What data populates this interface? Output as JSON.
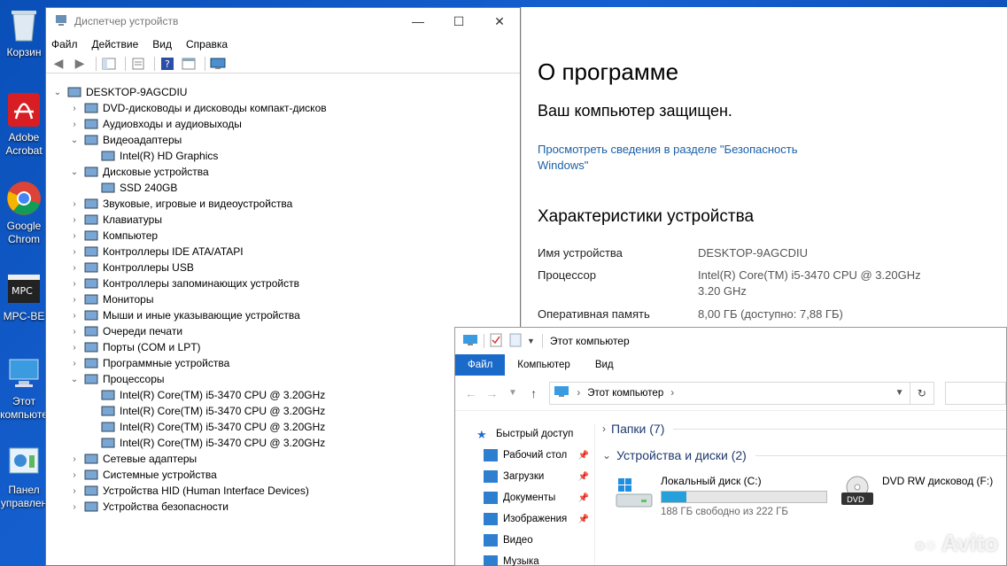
{
  "desktop": {
    "icons": [
      {
        "label": "Корзин",
        "icon": "recycle-bin-icon"
      },
      {
        "label": "Adobe Acrobat",
        "line1": "Adobe",
        "line2": "Acrobat",
        "icon": "acrobat-icon"
      },
      {
        "label": "Google Chrome",
        "line1": "Google",
        "line2": "Chrom",
        "icon": "chrome-icon"
      },
      {
        "label": "MPC-BE",
        "line1": "MPC-BE",
        "icon": "mpc-be-icon"
      },
      {
        "label": "Этот компьютер",
        "line1": "Этот",
        "line2": "компьюте",
        "icon": "this-pc-icon"
      },
      {
        "label": "Панель управления",
        "line1": "Панел",
        "line2": "управлен",
        "icon": "control-panel-icon"
      }
    ]
  },
  "device_manager": {
    "title": "Диспетчер устройств",
    "menu": [
      "Файл",
      "Действие",
      "Вид",
      "Справка"
    ],
    "root": "DESKTOP-9AGCDIU",
    "tree": [
      {
        "label": "DVD-дисководы и дисководы компакт-дисков",
        "expanded": false
      },
      {
        "label": "Аудиовходы и аудиовыходы",
        "expanded": false
      },
      {
        "label": "Видеоадаптеры",
        "expanded": true,
        "children": [
          "Intel(R) HD Graphics"
        ]
      },
      {
        "label": "Дисковые устройства",
        "expanded": true,
        "children": [
          "SSD 240GB"
        ]
      },
      {
        "label": "Звуковые, игровые и видеоустройства",
        "expanded": false
      },
      {
        "label": "Клавиатуры",
        "expanded": false
      },
      {
        "label": "Компьютер",
        "expanded": false
      },
      {
        "label": "Контроллеры IDE ATA/ATAPI",
        "expanded": false
      },
      {
        "label": "Контроллеры USB",
        "expanded": false
      },
      {
        "label": "Контроллеры запоминающих устройств",
        "expanded": false
      },
      {
        "label": "Мониторы",
        "expanded": false
      },
      {
        "label": "Мыши и иные указывающие устройства",
        "expanded": false
      },
      {
        "label": "Очереди печати",
        "expanded": false
      },
      {
        "label": "Порты (COM и LPT)",
        "expanded": false
      },
      {
        "label": "Программные устройства",
        "expanded": false
      },
      {
        "label": "Процессоры",
        "expanded": true,
        "children": [
          "Intel(R) Core(TM) i5-3470 CPU @ 3.20GHz",
          "Intel(R) Core(TM) i5-3470 CPU @ 3.20GHz",
          "Intel(R) Core(TM) i5-3470 CPU @ 3.20GHz",
          "Intel(R) Core(TM) i5-3470 CPU @ 3.20GHz"
        ]
      },
      {
        "label": "Сетевые адаптеры",
        "expanded": false
      },
      {
        "label": "Системные устройства",
        "expanded": false
      },
      {
        "label": "Устройства HID (Human Interface Devices)",
        "expanded": false
      },
      {
        "label": "Устройства безопасности",
        "expanded": false
      }
    ]
  },
  "about": {
    "title": "О программе",
    "protected": "Ваш компьютер защищен.",
    "security_link": "Просмотреть сведения в разделе \"Безопасность Windows\"",
    "specs_title": "Характеристики устройства",
    "specs": [
      {
        "key": "Имя устройства",
        "value": "DESKTOP-9AGCDIU"
      },
      {
        "key": "Процессор",
        "value": "Intel(R) Core(TM) i5-3470 CPU @ 3.20GHz 3.20 GHz"
      },
      {
        "key": "Оперативная память",
        "value": "8,00 ГБ (доступно: 7,88 ГБ)"
      }
    ]
  },
  "explorer": {
    "title": "Этот компьютер",
    "tabs": [
      "Файл",
      "Компьютер",
      "Вид"
    ],
    "address": "Этот компьютер",
    "nav": [
      {
        "label": "Быстрый доступ",
        "pinned": false,
        "icon": "star-icon"
      },
      {
        "label": "Рабочий стол",
        "pinned": true,
        "icon": "desktop-folder-icon"
      },
      {
        "label": "Загрузки",
        "pinned": true,
        "icon": "download-icon"
      },
      {
        "label": "Документы",
        "pinned": true,
        "icon": "documents-icon"
      },
      {
        "label": "Изображения",
        "pinned": true,
        "icon": "pictures-icon"
      },
      {
        "label": "Видео",
        "pinned": false,
        "icon": "video-icon"
      },
      {
        "label": "Музыка",
        "pinned": false,
        "icon": "music-icon"
      }
    ],
    "folders_group": "Папки (7)",
    "drives_group": "Устройства и диски (2)",
    "drives": [
      {
        "name": "Локальный диск (C:)",
        "free": "188 ГБ свободно из 222 ГБ",
        "used_fraction": 0.153
      },
      {
        "name": "DVD RW дисковод (F:)"
      }
    ]
  },
  "watermark": "Avito",
  "colors": {
    "accent": "#1a6ac9",
    "link": "#1a5fa8",
    "desktop": "#0a4fb8",
    "drive_bar": "#26a0da"
  }
}
